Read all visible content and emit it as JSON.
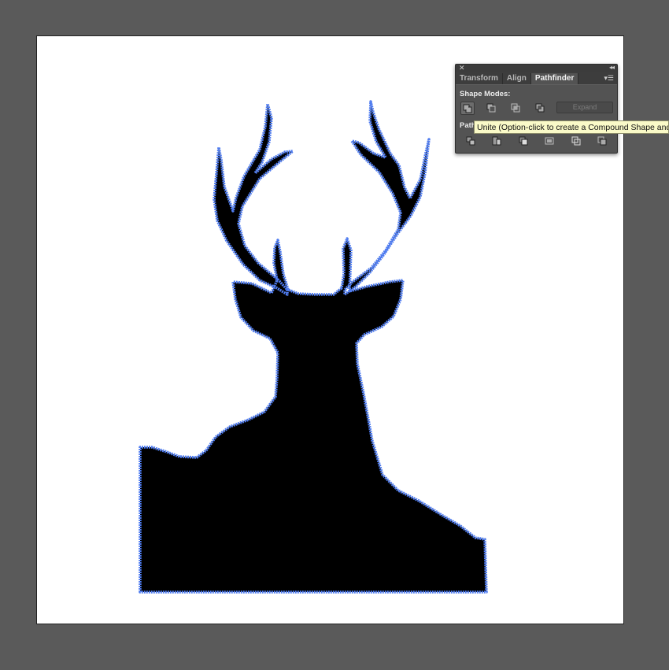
{
  "panel": {
    "close_icon": "close-icon",
    "collapse_icon": "double-chevron-icon",
    "tabs": [
      {
        "label": "Transform"
      },
      {
        "label": "Align"
      },
      {
        "label": "Pathfinder"
      }
    ],
    "active_tab": "Pathfinder",
    "menu_icon": "panel-menu-icon",
    "shape_modes_label": "Shape Modes:",
    "shape_mode_buttons": [
      "unite-icon",
      "minus-front-icon",
      "intersect-icon",
      "exclude-icon"
    ],
    "expand_label": "Expand",
    "pathfinders_label_visible": "Path",
    "pathfinder_buttons": [
      "divide-icon",
      "trim-icon",
      "merge-icon",
      "crop-icon",
      "outline-icon",
      "minus-back-icon"
    ]
  },
  "tooltip": {
    "text": "Unite (Option-click to create a Compound Shape and"
  },
  "colors": {
    "workspace": "#5a5a5a",
    "artboard": "#ffffff",
    "selection": "#4f7cf0",
    "shape_fill": "#000000",
    "panel_bg": "#535353",
    "tooltip_bg": "#fafac8"
  }
}
